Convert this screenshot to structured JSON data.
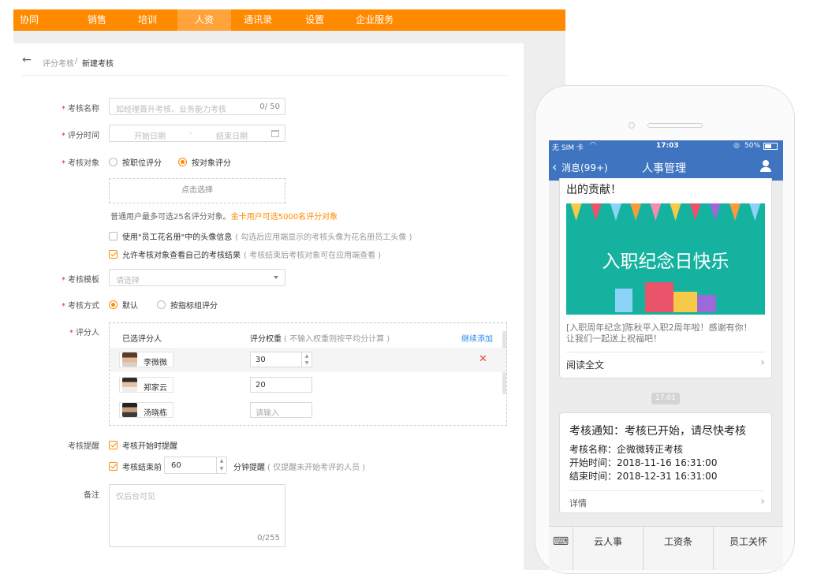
{
  "nav": {
    "items": [
      {
        "label": "协同"
      },
      {
        "label": "销售"
      },
      {
        "label": "培训"
      },
      {
        "label": "人资"
      },
      {
        "label": "通讯录"
      },
      {
        "label": "设置"
      },
      {
        "label": "企业服务"
      }
    ],
    "active_index": 3,
    "color": "#ff8a00"
  },
  "breadcrumb": {
    "parent": "评分考核",
    "separator": "/",
    "current": "新建考核"
  },
  "form": {
    "name": {
      "label": "考核名称",
      "placeholder": "如经理晋升考核、业务能力考核",
      "counter": "0/ 50"
    },
    "time": {
      "label": "评分时间",
      "start_placeholder": "开始日期",
      "dash": "-",
      "end_placeholder": "结束日期"
    },
    "target": {
      "label": "考核对象",
      "option1": "按职位评分",
      "option2": "按对象评分",
      "select_label": "点击选择",
      "note": "普通用户最多可选25名评分对象。",
      "note_gold": "金卡用户可选5000名评分对象",
      "chk1_label": "使用\"员工花名册\"中的头像信息",
      "chk1_hint": "( 勾选后应用端显示的考核头像为花名册员工头像 )",
      "chk2_label": "允许考核对象查看自己的考核结果",
      "chk2_hint": "( 考核结束后考核对象可在应用端查看 )"
    },
    "template": {
      "label": "考核模板",
      "placeholder": "请选择"
    },
    "method": {
      "label": "考核方式",
      "option1": "默认",
      "option2": "按指标组评分"
    },
    "evaluators": {
      "label": "评分人",
      "col1": "已选评分人",
      "col2": "评分权重",
      "col2_hint": "( 不输入权重则按平均分计算 )",
      "add_more": "继续添加",
      "rows": [
        {
          "name": "李微微",
          "weight": "30"
        },
        {
          "name": "郑家云",
          "weight": "20"
        },
        {
          "name": "汤晓栋",
          "weight": "请输入"
        }
      ]
    },
    "reminder": {
      "label": "考核提醒",
      "chk1": "考核开始时提醒",
      "chk2": "考核结束前",
      "minutes": "60",
      "suffix": "分钟提醒",
      "suffix_hint": "( 仅提醒未开始考评的人员 )"
    },
    "remark": {
      "label": "备注",
      "placeholder": "仅后台可见",
      "counter": "0/255"
    }
  },
  "phone": {
    "status": {
      "carrier": "无 SIM 卡",
      "time": "17:03",
      "battery": "50%"
    },
    "title": {
      "back": "消息(99+)",
      "title": "人事管理"
    },
    "card1": {
      "top_text": "出的贡献！",
      "banner_text": "入职纪念日快乐",
      "desc_line1": "[入职周年纪念]陈秋平入职2周年啦！感谢有你！",
      "desc_line2": "让我们一起送上祝福吧！",
      "link": "阅读全文"
    },
    "time_badge": "17:01",
    "card2": {
      "title": "考核通知：考核已开始，请尽快考核",
      "line1": "考核名称：企微微转正考核",
      "line2": "开始时间：2018-11-16 16:31:00",
      "line3": "结束时间：2018-12-31 16:31:00",
      "link": "详情"
    },
    "bottom": {
      "tab1": "云人事",
      "tab2": "工资条",
      "tab3": "员工关怀"
    }
  }
}
